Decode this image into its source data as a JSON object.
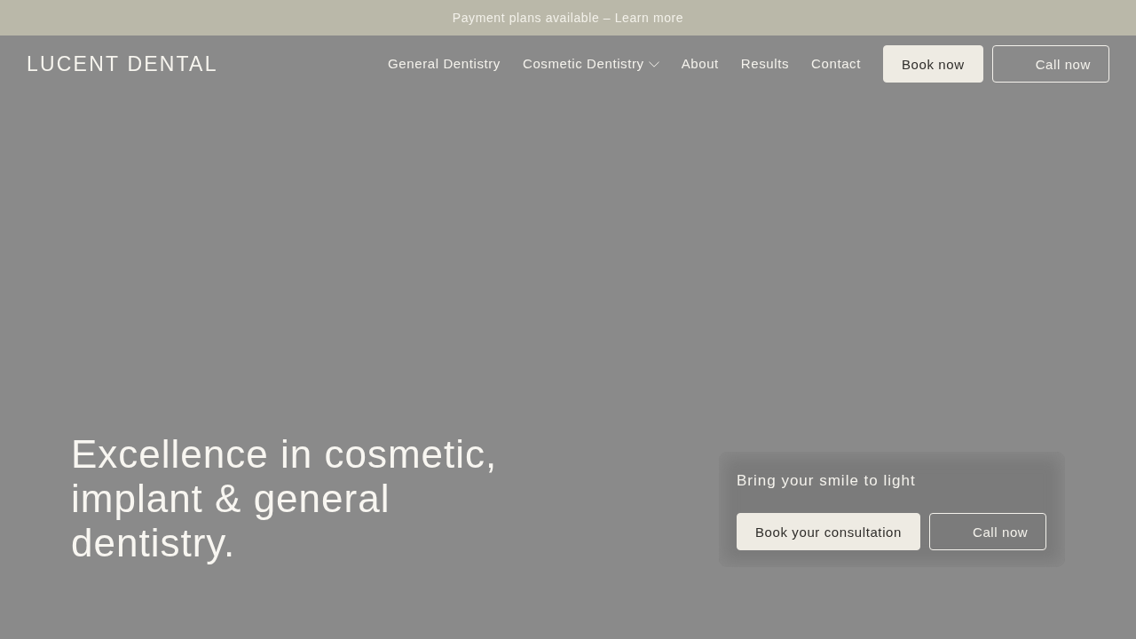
{
  "announcement_bar": {
    "text": "Payment plans available – Learn more"
  },
  "navbar": {
    "logo": "LUCENT DENTAL",
    "links": [
      {
        "label": "General Dentistry",
        "dropdown": false
      },
      {
        "label": "Cosmetic Dentistry",
        "dropdown": true
      },
      {
        "label": "About",
        "dropdown": false
      },
      {
        "label": "Results",
        "dropdown": false
      },
      {
        "label": "Contact",
        "dropdown": false
      }
    ],
    "buttons": [
      {
        "label": "Book now",
        "kind": "filled"
      },
      {
        "label": "Call now",
        "kind": "outline"
      }
    ]
  },
  "hero": {
    "headline": "Excellence in cosmetic, implant & general dentistry.",
    "card": {
      "title": "Bring your smile to light",
      "buttons": [
        {
          "label": "Book your consultation",
          "kind": "filled"
        },
        {
          "label": "Call now",
          "kind": "outline"
        }
      ]
    }
  }
}
